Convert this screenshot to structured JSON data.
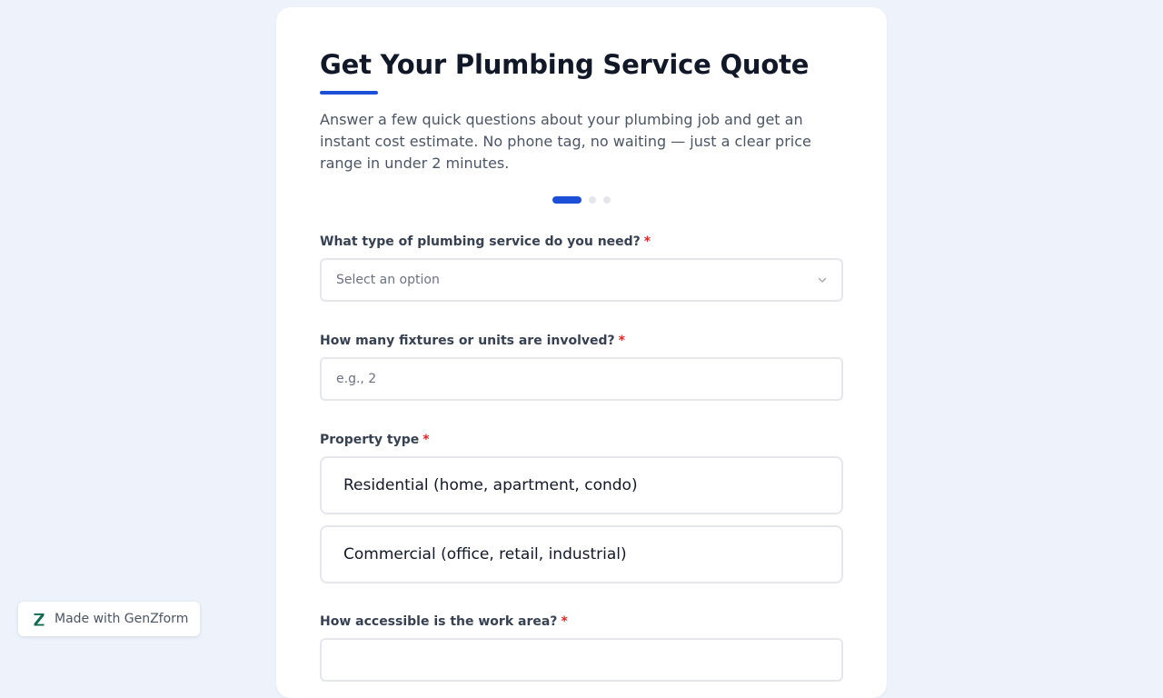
{
  "form": {
    "title": "Get Your Plumbing Service Quote",
    "description": "Answer a few quick questions about your plumbing job and get an instant cost estimate. No phone tag, no waiting — just a clear price range in under 2 minutes.",
    "progress": {
      "current_step": 1,
      "total_steps": 3
    },
    "required_marker": "*",
    "questions": {
      "service_type": {
        "label": "What type of plumbing service do you need?",
        "placeholder": "Select an option"
      },
      "fixtures": {
        "label": "How many fixtures or units are involved?",
        "placeholder": "e.g., 2"
      },
      "property_type": {
        "label": "Property type",
        "options": [
          "Residential (home, apartment, condo)",
          "Commercial (office, retail, industrial)"
        ]
      },
      "accessibility": {
        "label": "How accessible is the work area?"
      }
    }
  },
  "badge": {
    "text": "Made with GenZform",
    "logo_icon": "z-logo-icon"
  },
  "colors": {
    "accent": "#1d4ed8",
    "required": "#dc2626",
    "background": "#eef3fb",
    "logo": "#0f6b4f"
  }
}
